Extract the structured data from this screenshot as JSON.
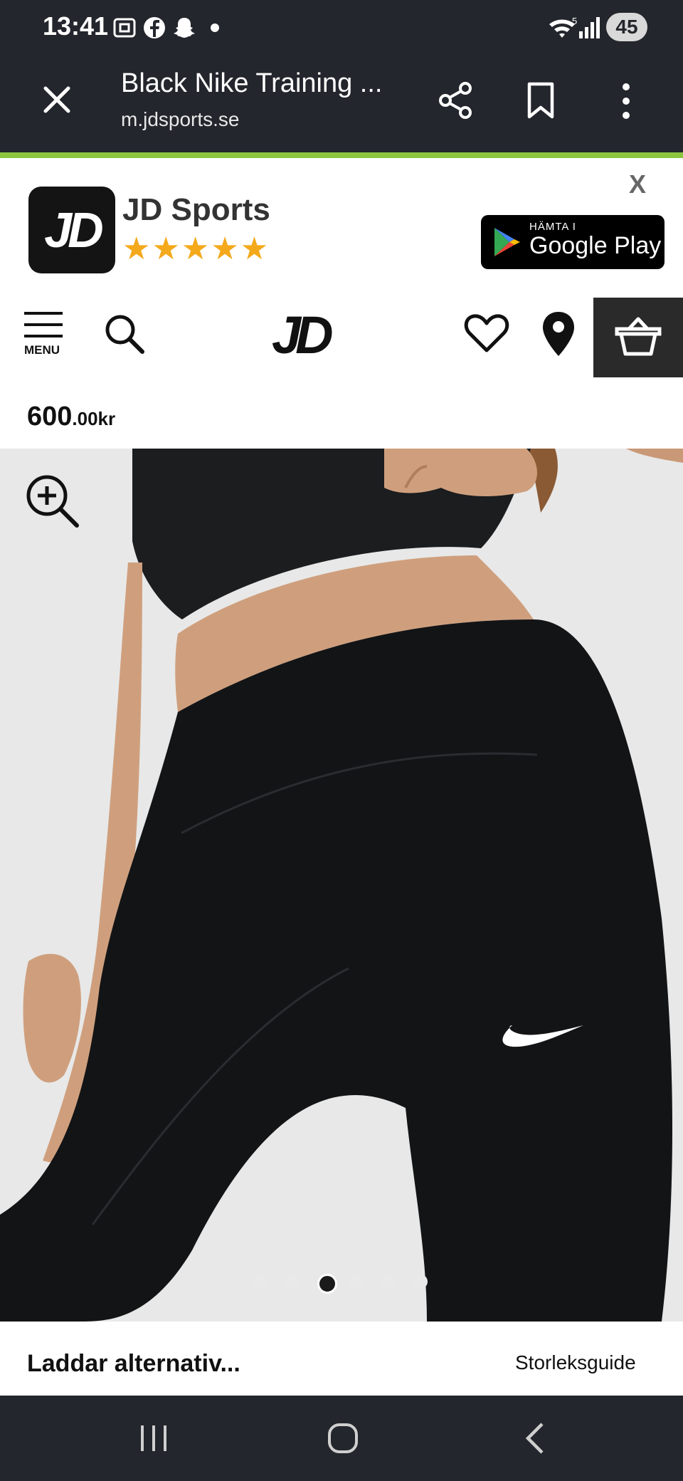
{
  "status_bar": {
    "time": "13:41",
    "battery": "45",
    "network": "5"
  },
  "browser": {
    "title": "Black Nike Training ...",
    "url": "m.jdsports.se"
  },
  "app_banner": {
    "app_name": "JD Sports",
    "logo_text": "JD",
    "stars": "★★★★★",
    "close_label": "X",
    "store_small": "HÄMTA I",
    "store_big": "Google Play"
  },
  "site_header": {
    "menu_label": "MENU",
    "brand": "JD"
  },
  "product": {
    "price_main": "600",
    "price_decimal": ".00kr",
    "gallery_index": 3,
    "gallery_count": 6
  },
  "bottom_bar": {
    "loading_text": "Laddar alternativ...",
    "size_guide": "Storleksguide"
  },
  "colors": {
    "dark": "#23262c",
    "accent_green": "#8cc63f",
    "star": "#f4a91b"
  }
}
